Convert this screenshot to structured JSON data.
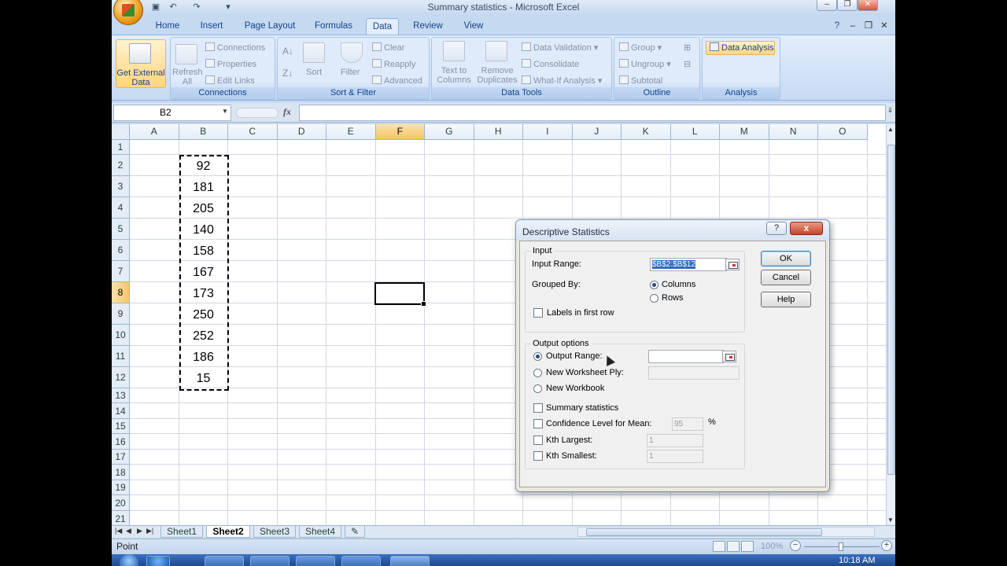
{
  "window": {
    "title": "Summary statistics - Microsoft Excel"
  },
  "tabs": [
    "Home",
    "Insert",
    "Page Layout",
    "Formulas",
    "Data",
    "Review",
    "View"
  ],
  "active_tab": "Data",
  "ribbon": {
    "get_external_data": "Get External Data",
    "connections": {
      "label": "Connections",
      "refresh_all": "Refresh All",
      "items": [
        "Connections",
        "Properties",
        "Edit Links"
      ]
    },
    "sort_filter": {
      "label": "Sort & Filter",
      "sort": "Sort",
      "filter": "Filter",
      "items": [
        "Clear",
        "Reapply",
        "Advanced"
      ]
    },
    "data_tools": {
      "label": "Data Tools",
      "text_to_columns": "Text to Columns",
      "remove_duplicates": "Remove Duplicates",
      "items": [
        "Data Validation",
        "Consolidate",
        "What-If Analysis"
      ]
    },
    "outline": {
      "label": "Outline",
      "items": [
        "Group",
        "Ungroup",
        "Subtotal"
      ]
    },
    "analysis": {
      "label": "Analysis",
      "data_analysis": "Data Analysis"
    }
  },
  "formula_bar": {
    "name_box": "B2",
    "fx": "fx",
    "formula": ""
  },
  "grid": {
    "columns": [
      "A",
      "B",
      "C",
      "D",
      "E",
      "F",
      "G",
      "H",
      "I",
      "J",
      "K",
      "L",
      "M",
      "N",
      "O"
    ],
    "selected_column": "F",
    "rows": [
      "1",
      "2",
      "3",
      "4",
      "5",
      "6",
      "7",
      "8",
      "9",
      "10",
      "11",
      "12",
      "13",
      "14",
      "15",
      "16",
      "17",
      "18",
      "19",
      "20",
      "21"
    ],
    "selected_row": "8",
    "column_b_values": [
      "92",
      "181",
      "205",
      "140",
      "158",
      "167",
      "173",
      "250",
      "252",
      "186",
      "15"
    ]
  },
  "sheets": [
    "Sheet1",
    "Sheet2",
    "Sheet3",
    "Sheet4"
  ],
  "active_sheet": "Sheet2",
  "status": {
    "mode": "Point",
    "zoom": "100%"
  },
  "taskbar": {
    "clock": "10:18 AM"
  },
  "dialog": {
    "title": "Descriptive Statistics",
    "help_glyph": "?",
    "close_glyph": "x",
    "input": {
      "legend": "Input",
      "input_range_label": "Input Range:",
      "input_range_value": "$B$2:$B$12",
      "grouped_by_label": "Grouped By:",
      "columns_label": "Columns",
      "rows_label": "Rows",
      "labels_first_row": "Labels in first row"
    },
    "output": {
      "legend": "Output options",
      "output_range_label": "Output Range:",
      "new_worksheet_ply": "New Worksheet Ply:",
      "new_workbook": "New Workbook",
      "summary_statistics": "Summary statistics",
      "confidence_label": "Confidence Level for Mean:",
      "confidence_value": "95",
      "percent": "%",
      "kth_largest": "Kth Largest:",
      "kth_largest_value": "1",
      "kth_smallest": "Kth Smallest:",
      "kth_smallest_value": "1"
    },
    "buttons": {
      "ok": "OK",
      "cancel": "Cancel",
      "help": "Help"
    }
  }
}
